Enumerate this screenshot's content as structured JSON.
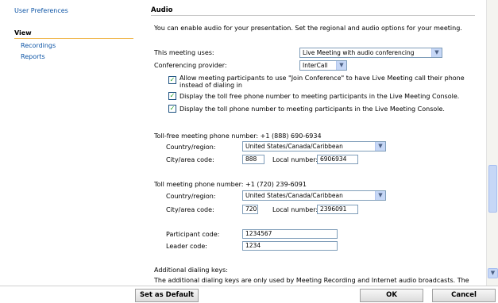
{
  "sidebar": {
    "user_preferences": "User Preferences",
    "view_heading": "View",
    "recordings": "Recordings",
    "reports": "Reports"
  },
  "audio": {
    "title": "Audio",
    "intro": "You can enable audio for your presentation. Set the regional and audio options for your meeting.",
    "meeting_uses_label": "This meeting uses:",
    "meeting_uses_value": "Live Meeting with audio conferencing",
    "provider_label": "Conferencing provider:",
    "provider_value": "InterCall",
    "checkboxes": [
      {
        "line1": "Allow meeting participants to use \"Join Conference\" to have Live Meeting call their phone",
        "line2": "instead of dialing in",
        "checked": true
      },
      {
        "line1": "Display the toll free phone number to meeting participants in the Live Meeting Console.",
        "line2": "",
        "checked": true
      },
      {
        "line1": "Display the toll phone number to meeting participants in the Live Meeting Console.",
        "line2": "",
        "checked": true
      }
    ],
    "toll_free": {
      "heading": "Toll-free meeting phone number: +1 (888) 690-6934",
      "country_label": "Country/region:",
      "country_value": "United States/Canada/Caribbean",
      "city_label": "City/area code:",
      "city_value": "888",
      "local_label": "Local number:",
      "local_value": "6906934"
    },
    "toll": {
      "heading": "Toll meeting phone number: +1 (720) 239-6091",
      "country_label": "Country/region:",
      "country_value": "United States/Canada/Caribbean",
      "city_label": "City/area code:",
      "city_value": "720",
      "local_label": "Local number:",
      "local_value": "2396091"
    },
    "participant_label": "Participant code:",
    "participant_value": "1234567",
    "leader_label": "Leader code:",
    "leader_value": "1234",
    "additional_heading": "Additional dialing keys:",
    "additional_text": "The additional dialing keys are only used by Meeting Recording and Internet audio broadcasts. The"
  },
  "buttons": {
    "set_default": "Set as Default",
    "ok": "OK",
    "cancel": "Cancel"
  },
  "glyphs": {
    "dropdown": "▼",
    "check": "✓"
  },
  "colors": {
    "link": "#0b53a5",
    "accent_rule": "#f0b850",
    "checkbox_check": "#21a121"
  }
}
